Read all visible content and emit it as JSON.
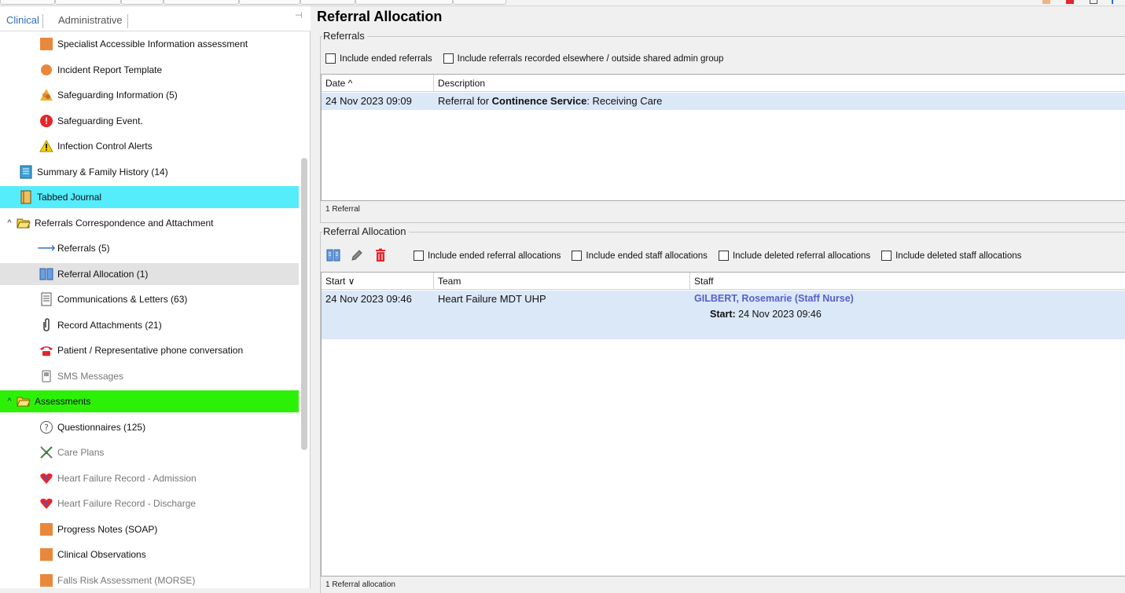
{
  "tabs": {
    "clinical": "Clinical",
    "administrative": "Administrative"
  },
  "tree": [
    {
      "label": "Specialist Accessible Information assessment",
      "icon": "orange-square-icon",
      "indent": 50,
      "dim": false
    },
    {
      "label": "Incident Report Template",
      "icon": "orange-circle-icon",
      "indent": 50,
      "dim": false
    },
    {
      "label": "Safeguarding Information (5)",
      "icon": "safeguarding-icon",
      "indent": 50,
      "dim": false
    },
    {
      "label": "Safeguarding Event.",
      "icon": "alert-circle-icon",
      "indent": 50,
      "dim": false
    },
    {
      "label": "Infection Control Alerts",
      "icon": "warning-triangle-icon",
      "indent": 50,
      "dim": false
    },
    {
      "label": "Summary & Family History (14)",
      "icon": "summary-book-icon",
      "indent": 24,
      "dim": false
    },
    {
      "label": "Tabbed Journal",
      "icon": "journal-icon",
      "indent": 24,
      "dim": false,
      "sel": "cyan"
    },
    {
      "label": "Referrals Correspondence and Attachment",
      "icon": "folder-open-icon",
      "indent": 6,
      "dim": false,
      "caret": "^"
    },
    {
      "label": "Referrals (5)",
      "icon": "arrow-right-icon",
      "indent": 50,
      "dim": false
    },
    {
      "label": "Referral Allocation (1)",
      "icon": "referral-allocation-icon",
      "indent": 50,
      "dim": false,
      "sel": "grey"
    },
    {
      "label": "Communications & Letters (63)",
      "icon": "document-icon",
      "indent": 50,
      "dim": false
    },
    {
      "label": "Record Attachments (21)",
      "icon": "paperclip-icon",
      "indent": 50,
      "dim": false
    },
    {
      "label": "Patient / Representative phone conversation",
      "icon": "phone-icon",
      "indent": 50,
      "dim": false
    },
    {
      "label": "SMS Messages",
      "icon": "sms-icon",
      "indent": 50,
      "dim": true
    },
    {
      "label": "Assessments",
      "icon": "folder-open-icon",
      "indent": 6,
      "dim": false,
      "caret": "^",
      "sel": "green"
    },
    {
      "label": "Questionnaires (125)",
      "icon": "question-circle-icon",
      "indent": 50,
      "dim": false
    },
    {
      "label": "Care Plans",
      "icon": "care-plans-icon",
      "indent": 50,
      "dim": true
    },
    {
      "label": "Heart Failure Record - Admission",
      "icon": "heart-icon",
      "indent": 50,
      "dim": true
    },
    {
      "label": "Heart Failure Record - Discharge",
      "icon": "heart-icon",
      "indent": 50,
      "dim": true
    },
    {
      "label": "Progress Notes (SOAP)",
      "icon": "orange-square-icon",
      "indent": 50,
      "dim": false
    },
    {
      "label": "Clinical Observations",
      "icon": "orange-square-icon",
      "indent": 50,
      "dim": false
    },
    {
      "label": "Falls Risk Assessment (MORSE)",
      "icon": "orange-square-icon",
      "indent": 50,
      "dim": true
    }
  ],
  "main": {
    "title": "Referral Allocation",
    "referrals": {
      "caption": "Referrals",
      "checkboxes": [
        "Include ended referrals",
        "Include referrals recorded elsewhere / outside shared admin group"
      ],
      "columns": [
        "Date ^",
        "Description"
      ],
      "row": {
        "date": "24 Nov 2023 09:09",
        "desc_prefix": "Referral for ",
        "desc_bold": "Continence Service",
        "desc_suffix": ": Receiving Care"
      },
      "count": "1 Referral"
    },
    "allocation": {
      "caption": "Referral Allocation",
      "checkboxes": [
        "Include ended referral allocations",
        "Include ended staff allocations",
        "Include deleted referral allocations",
        "Include deleted staff allocations"
      ],
      "columns": [
        "Start ∨",
        "Team",
        "Staff"
      ],
      "row": {
        "start": "24 Nov 2023 09:46",
        "team": "Heart Failure MDT UHP",
        "staff": "GILBERT, Rosemarie (Staff Nurse)",
        "staff_start_label": "Start:",
        "staff_start_value": "24 Nov 2023 09:46"
      },
      "count": "1 Referral allocation"
    }
  },
  "colors": {
    "cyan": "#55ecfc",
    "green": "#2cf107",
    "grey": "#e2e2e2",
    "row_blue": "#dbe8f8",
    "link_blue": "#2a6ebb"
  }
}
